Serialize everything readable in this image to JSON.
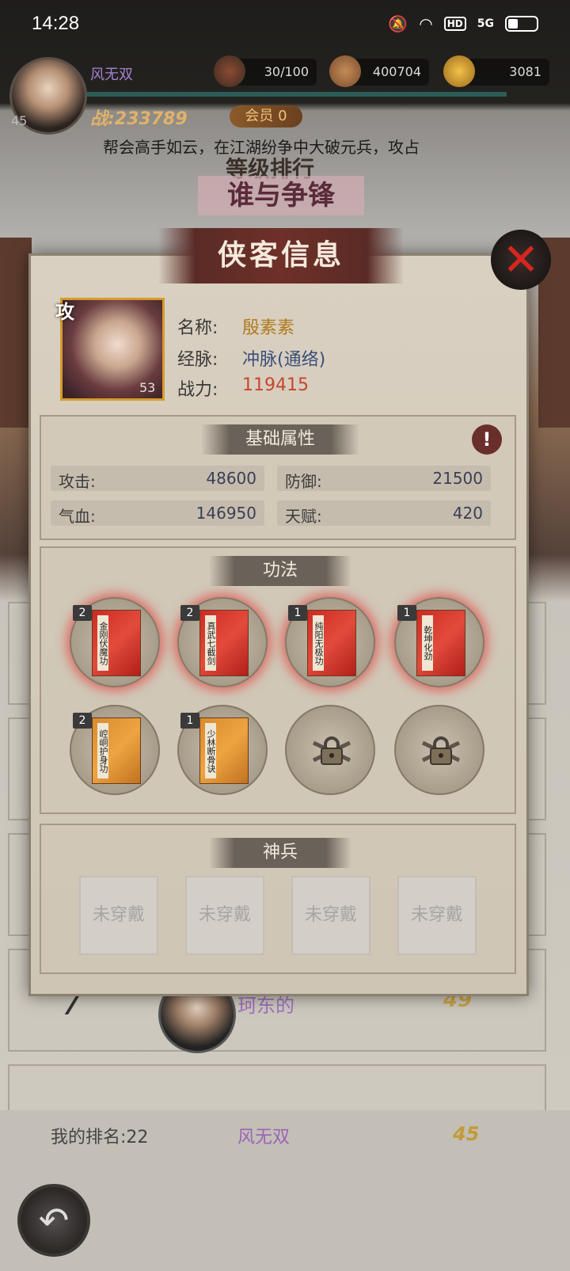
{
  "status_bar": {
    "time": "14:28",
    "hd": "HD",
    "net": "5G"
  },
  "player": {
    "name": "风无双",
    "level": "45",
    "power": "战:233789",
    "vip": "会员 0"
  },
  "resources": [
    {
      "icon": "stamina-jar-icon",
      "value": "30/100"
    },
    {
      "icon": "copper-coin-icon",
      "value": "400704"
    },
    {
      "icon": "gold-ingot-icon",
      "value": "3081"
    }
  ],
  "ticker": "帮会高手如云，在江湖纷争中大破元兵，攻占",
  "ranking": {
    "subtitle": "等级排行",
    "title": "谁与争锋"
  },
  "modal": {
    "title": "侠客信息",
    "hero": {
      "tag": "攻",
      "level": "53",
      "name_label": "名称:",
      "name": "殷素素",
      "meridian_label": "经脉:",
      "meridian": "冲脉(通络)",
      "power_label": "战力:",
      "power": "119415"
    },
    "basic": {
      "title": "基础属性",
      "info_icon": "!",
      "stats": [
        {
          "label": "攻击:",
          "value": "48600"
        },
        {
          "label": "防御:",
          "value": "21500"
        },
        {
          "label": "气血:",
          "value": "146950"
        },
        {
          "label": "天赋:",
          "value": "420"
        }
      ]
    },
    "skills": {
      "title": "功法",
      "items": [
        {
          "level": "2",
          "name": "金刚伏魔功",
          "color": "red"
        },
        {
          "level": "2",
          "name": "真武七截剑",
          "color": "red"
        },
        {
          "level": "1",
          "name": "纯阳无极功",
          "color": "red"
        },
        {
          "level": "1",
          "name": "乾坤化劲",
          "color": "red"
        },
        {
          "level": "2",
          "name": "崆峒护身功",
          "color": "orange"
        },
        {
          "level": "1",
          "name": "少林断骨诀",
          "color": "orange"
        },
        {
          "level": "",
          "name": "",
          "color": "locked"
        },
        {
          "level": "",
          "name": "",
          "color": "locked"
        }
      ]
    },
    "weapons": {
      "title": "神兵",
      "slots": [
        "未穿戴",
        "未穿戴",
        "未穿戴",
        "未穿戴"
      ]
    }
  },
  "list_row": {
    "rank": "7",
    "name": "珂东的",
    "level": "49"
  },
  "footer": {
    "my_rank": "我的排名:22",
    "my_name": "风无双",
    "my_level": "45"
  }
}
